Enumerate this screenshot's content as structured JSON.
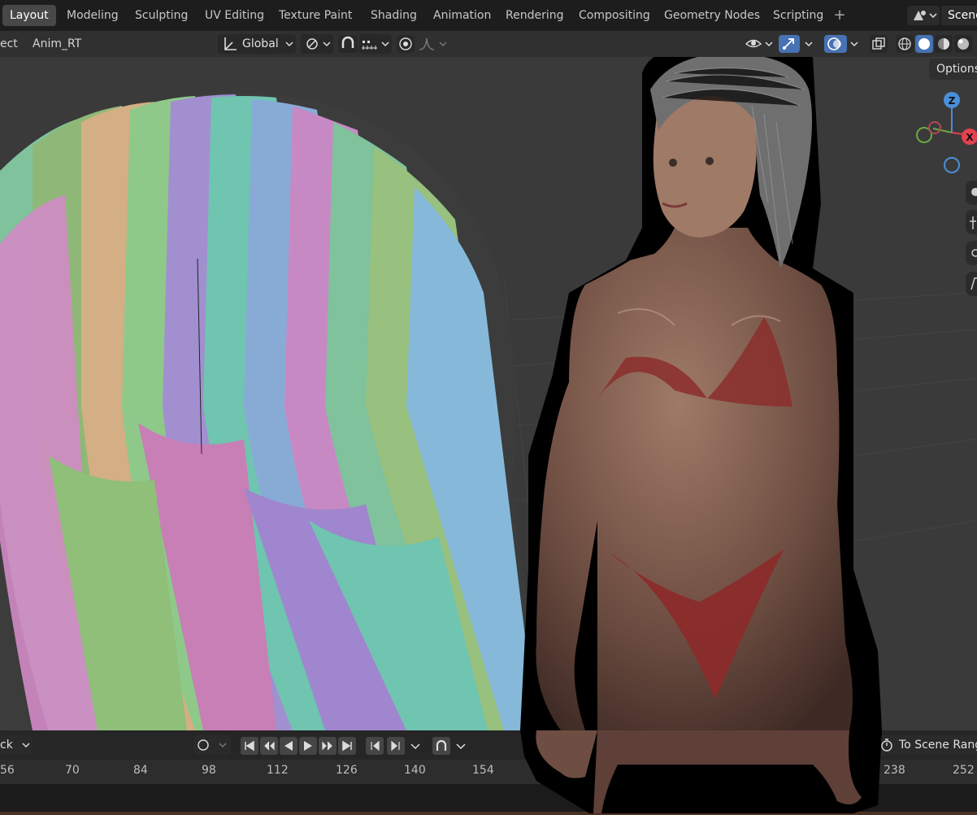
{
  "workspaces": [
    "Layout",
    "Modeling",
    "Sculpting",
    "UV Editing",
    "Texture Paint",
    "Shading",
    "Animation",
    "Rendering",
    "Compositing",
    "Geometry Nodes",
    "Scripting"
  ],
  "active_workspace": "Layout",
  "scene": {
    "name": "Scene"
  },
  "viewport_header": {
    "select_partial": "ect",
    "object_name": "Anim_RT",
    "transform_orientation": "Global",
    "options_label": "Options"
  },
  "gizmo": {
    "z": "Z",
    "x": "X"
  },
  "timeline": {
    "mode_partial": "ck",
    "range_label": "To Scene Rang",
    "frames": [
      "56",
      "70",
      "84",
      "98",
      "112",
      "126",
      "140",
      "154",
      "238",
      "252"
    ]
  },
  "colors": {
    "accent": "#4772b3",
    "header": "#1d1d1d",
    "viewport": "#3a3a3a"
  }
}
